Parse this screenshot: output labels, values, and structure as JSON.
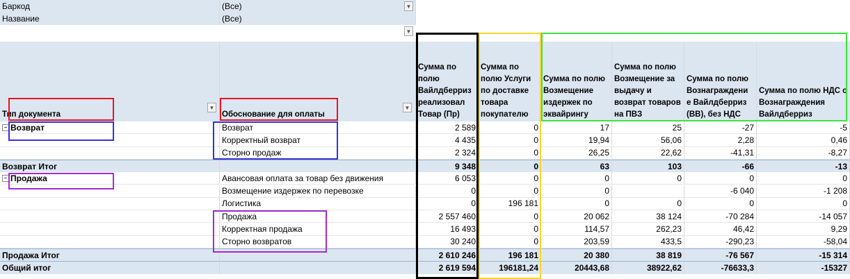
{
  "filters": [
    {
      "label": "Баркод",
      "value": "(Все)"
    },
    {
      "label": "Название",
      "value": "(Все)"
    }
  ],
  "headers": {
    "col1": "Тип документа",
    "col2": "Обоснование для оплаты",
    "values": [
      "Сумма по полю Вайлдберриз реализовал Товар (Пр)",
      "Сумма по полю Услуги по доставке товара покупателю",
      "Сумма по полю Возмещение издержек по эквайрингу",
      "Сумма по полю Возмещение за выдачу и возврат товаров на ПВЗ",
      "Сумма по полю Вознаграждени е Вайлдберриз (ВВ), без НДС",
      "Сумма по полю НДС с Вознаграждения Вайлдберриз"
    ]
  },
  "rows": [
    {
      "type": "Возврат",
      "reason": "Возврат",
      "v": [
        "2 589",
        "0",
        "17",
        "25",
        "-27",
        "-5"
      ]
    },
    {
      "type": "",
      "reason": "Корректный возврат",
      "v": [
        "4 435",
        "0",
        "19,94",
        "56,06",
        "2,28",
        "0,46"
      ]
    },
    {
      "type": "",
      "reason": "Сторно продаж",
      "v": [
        "2 324",
        "0",
        "26,25",
        "22,62",
        "-41,31",
        "-8,27"
      ]
    },
    {
      "type": "Возврат Итог",
      "reason": "",
      "total": true,
      "v": [
        "9 348",
        "0",
        "63",
        "103",
        "-66",
        "-13"
      ]
    },
    {
      "type": "Продажа",
      "reason": "Авансовая оплата за товар без движения",
      "v": [
        "6 053",
        "0",
        "0",
        "0",
        "0",
        "0"
      ]
    },
    {
      "type": "",
      "reason": "Возмещение издержек по перевозке",
      "v": [
        "0",
        "0",
        "0",
        "",
        "-6 040",
        "-1 208"
      ]
    },
    {
      "type": "",
      "reason": "Логистика",
      "v": [
        "0",
        "196 181",
        "0",
        "0",
        "0",
        "0"
      ]
    },
    {
      "type": "",
      "reason": "Продажа",
      "v": [
        "2 557 460",
        "0",
        "20 062",
        "38 124",
        "-70 284",
        "-14 057"
      ]
    },
    {
      "type": "",
      "reason": "Корректная продажа",
      "v": [
        "16 493",
        "0",
        "114,57",
        "262,23",
        "46,42",
        "9,29"
      ]
    },
    {
      "type": "",
      "reason": "Сторно возвратов",
      "v": [
        "30 240",
        "0",
        "203,59",
        "433,5",
        "-290,23",
        "-58,04"
      ]
    },
    {
      "type": "Продажа Итог",
      "reason": "",
      "total": true,
      "v": [
        "2 610 246",
        "196 181",
        "20 380",
        "38 819",
        "-76 567",
        "-15 314"
      ]
    },
    {
      "type": "Общий итог",
      "reason": "",
      "total": true,
      "v": [
        "2 619 594",
        "196181,24",
        "20443,68",
        "38922,62",
        "-76633,3",
        "-15327"
      ]
    }
  ],
  "colors": {
    "header_bg": "#dce6f1",
    "red": "#e8141e",
    "blue": "#3b2fd6",
    "purple": "#a22bd0",
    "black": "#000000",
    "yellow": "#f6d62a",
    "green": "#3ee23e"
  },
  "icons": {
    "dropdown": "dropdown-arrow-icon",
    "collapse": "collapse-minus-icon"
  }
}
